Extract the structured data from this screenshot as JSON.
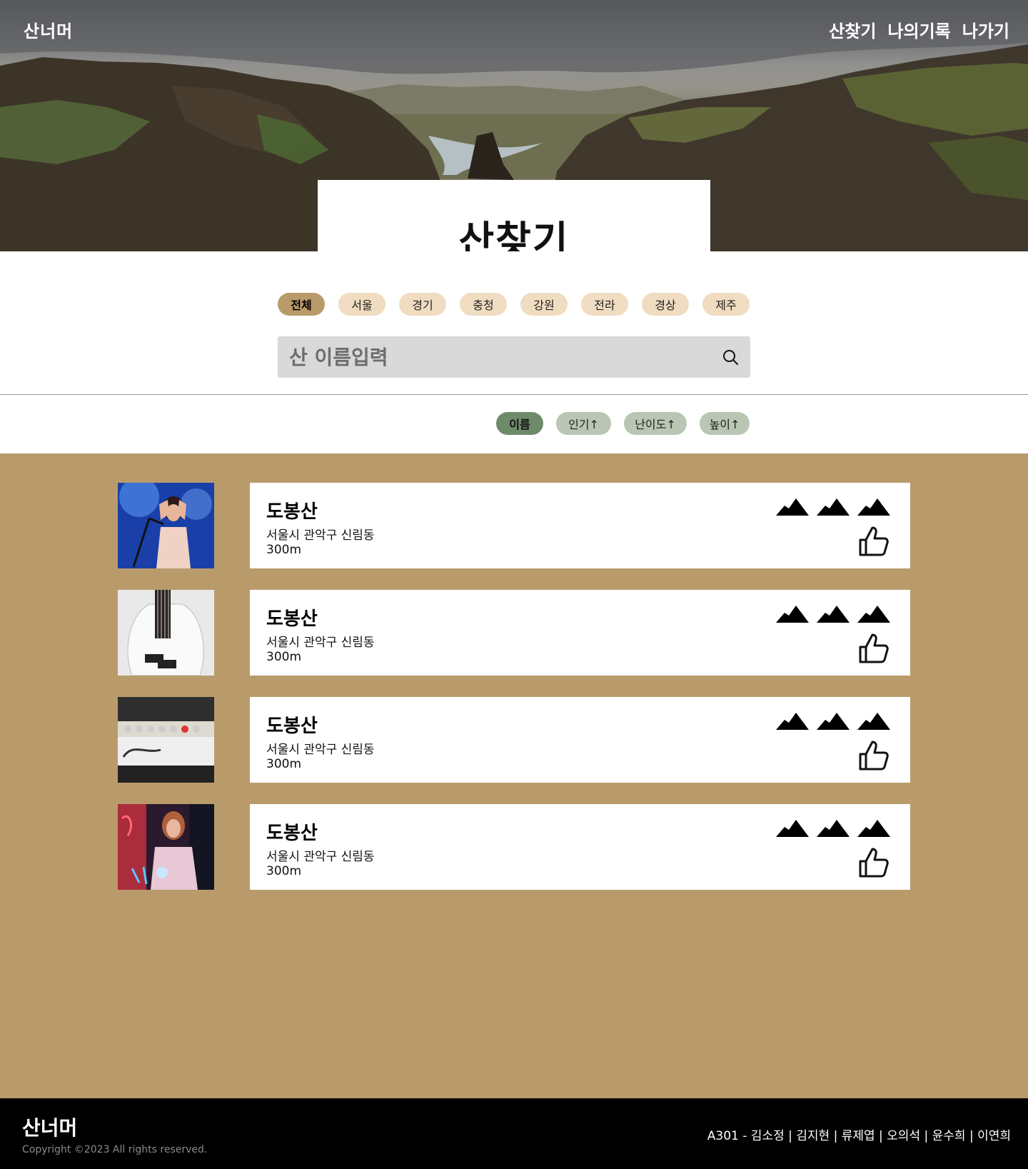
{
  "header": {
    "logo": "산너머",
    "nav": [
      "산찾기",
      "나의기록",
      "나가기"
    ]
  },
  "hero": {
    "title": "산찾기"
  },
  "filters": {
    "regions": [
      "전체",
      "서울",
      "경기",
      "충청",
      "강원",
      "전라",
      "경상",
      "제주"
    ],
    "active_region": "전체",
    "search_placeholder": "산 이름입력",
    "search_icon": "search-icon"
  },
  "sort": {
    "options": [
      "이름",
      "인기↑",
      "난이도↑",
      "높이↑"
    ],
    "active": "이름"
  },
  "mountains": [
    {
      "name": "도봉산",
      "address": "서울시 관악구 신림동",
      "height": "300m",
      "difficulty": 3,
      "thumb": "concert-singer-photo"
    },
    {
      "name": "도봉산",
      "address": "서울시 관악구 신림동",
      "height": "300m",
      "difficulty": 3,
      "thumb": "bass-guitar-photo"
    },
    {
      "name": "도봉산",
      "address": "서울시 관악구 신림동",
      "height": "300m",
      "difficulty": 3,
      "thumb": "guitar-amp-photo"
    },
    {
      "name": "도봉산",
      "address": "서울시 관악구 신림동",
      "height": "300m",
      "difficulty": 3,
      "thumb": "neon-portrait-photo"
    }
  ],
  "icons": {
    "difficulty": "mountain-icon",
    "like": "thumbs-up-icon"
  },
  "footer": {
    "logo": "산너머",
    "copyright": "Copyright ©2023 All rights reserved.",
    "credits": "A301 - 김소정 | 김지현 | 류제엽 | 오의석 | 윤수희 | 이연희"
  },
  "colors": {
    "list_background": "#b99b6b",
    "region_pill": "#f0dcc0",
    "region_pill_active": "#b99b6b",
    "sort_pill": "#b8c6b3",
    "sort_pill_active": "#6e8a6a",
    "footer": "#000000"
  }
}
